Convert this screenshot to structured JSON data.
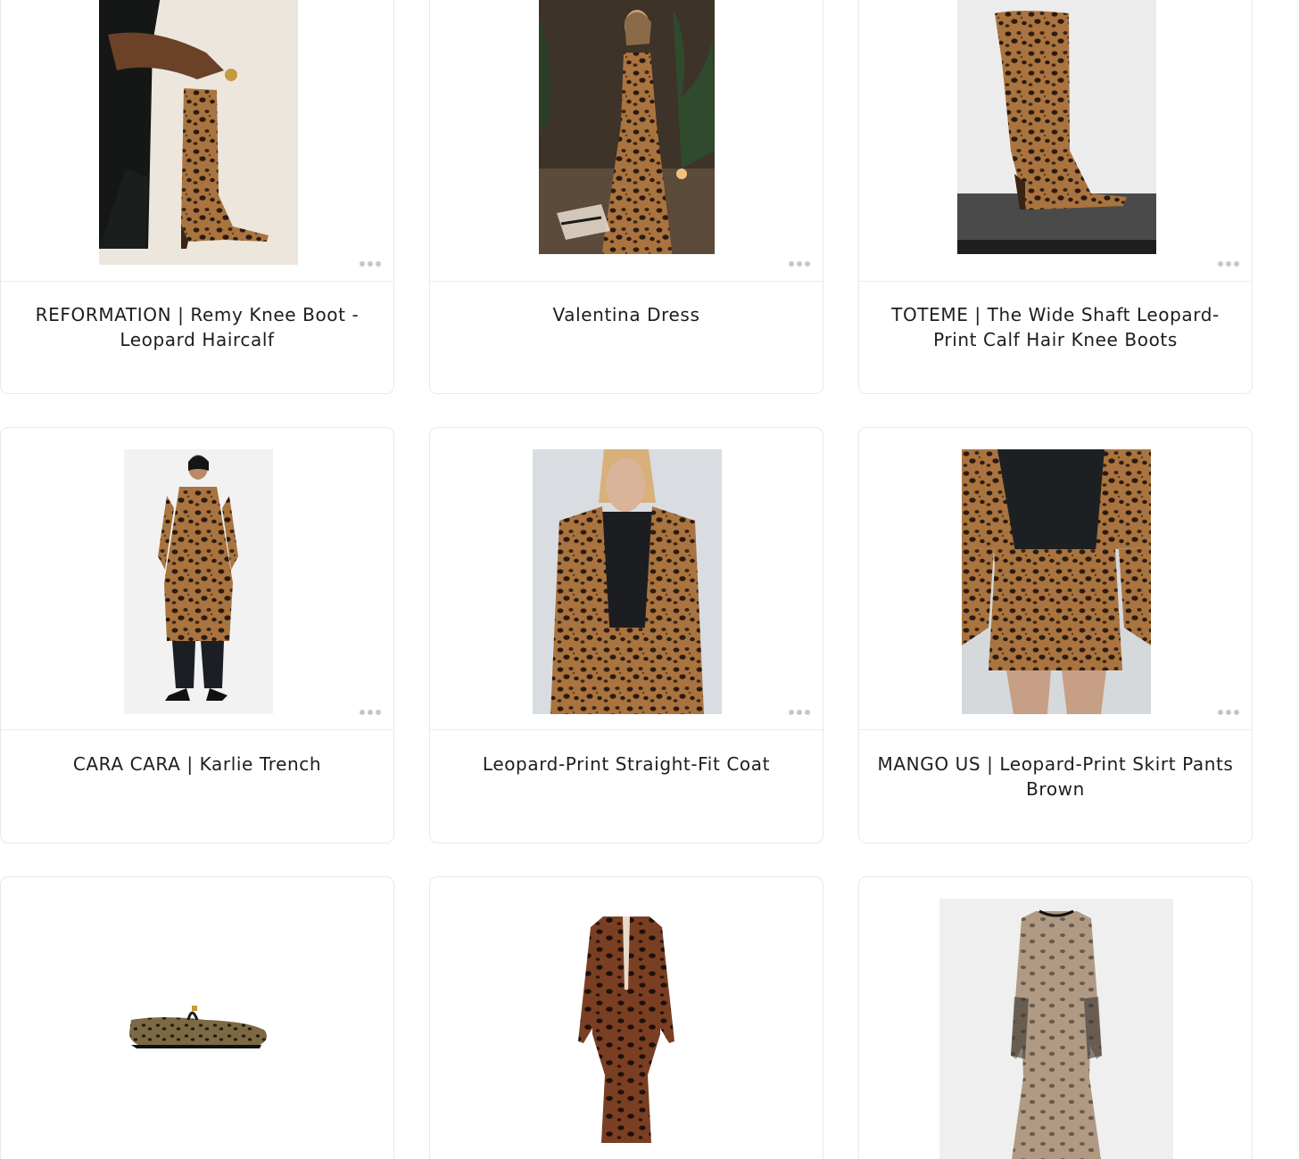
{
  "products": [
    {
      "title": "REFORMATION | Remy Knee Boot - Leopard Haircalf",
      "image": "leopard-knee-boot-on-model"
    },
    {
      "title": "Valentina Dress",
      "image": "leopard-slip-gown-on-model"
    },
    {
      "title": "TOTEME | The Wide Shaft Leopard-Print Calf Hair Knee Boots",
      "image": "leopard-calf-hair-boot"
    },
    {
      "title": "CARA CARA | Karlie Trench",
      "image": "leopard-trench-on-model"
    },
    {
      "title": "Leopard-Print Straight-Fit Coat",
      "image": "leopard-coat-on-model"
    },
    {
      "title": "MANGO US | Leopard-Print Skirt Pants Brown",
      "image": "leopard-skirt-pants-on-model"
    },
    {
      "title": "",
      "image": "leopard-ballet-flat"
    },
    {
      "title": "",
      "image": "leopard-long-sleeve-midi-dress"
    },
    {
      "title": "",
      "image": "leopard-mesh-maxi-dress"
    }
  ],
  "colors": {
    "leopard_base": "#a9743f",
    "leopard_spot": "#2b1a10",
    "border": "#e9e9e9",
    "text": "#1d1d1d",
    "dots": "#c7c7c7"
  }
}
